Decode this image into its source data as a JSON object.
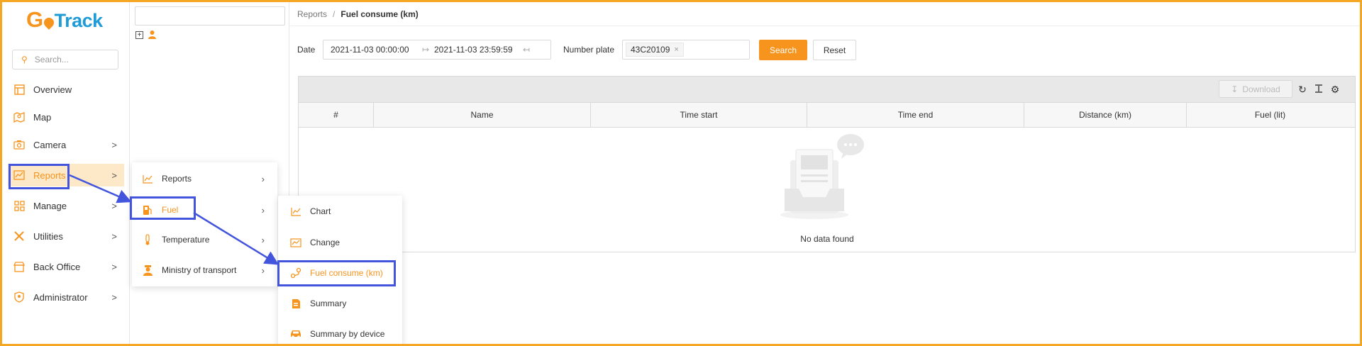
{
  "logo": {
    "text_g": "G",
    "text_rest": "Track",
    "text_o": "o"
  },
  "nav": {
    "search_placeholder": "Search...",
    "items": [
      {
        "label": "Overview",
        "icon": "layout-icon"
      },
      {
        "label": "Map",
        "icon": "map-icon"
      },
      {
        "label": "Camera",
        "icon": "camera-icon",
        "chevron": ">"
      },
      {
        "label": "Reports",
        "icon": "chart-icon",
        "chevron": ">"
      },
      {
        "label": "Manage",
        "icon": "grid-icon",
        "chevron": ">"
      },
      {
        "label": "Utilities",
        "icon": "tools-icon",
        "chevron": ">"
      },
      {
        "label": "Back Office",
        "icon": "store-icon",
        "chevron": ">"
      },
      {
        "label": "Administrator",
        "icon": "shield-icon",
        "chevron": ">"
      }
    ]
  },
  "tree": {
    "expand": "+"
  },
  "breadcrumb": {
    "parent": "Reports",
    "sep": "/",
    "current": "Fuel consume (km)"
  },
  "filters": {
    "date_label": "Date",
    "date_start": "2021-11-03 00:00:00",
    "date_end": "2021-11-03 23:59:59",
    "plate_label": "Number plate",
    "plate_value": "43C20109",
    "search_label": "Search",
    "reset_label": "Reset"
  },
  "grid": {
    "download_label": "Download",
    "columns": [
      "#",
      "Name",
      "Time start",
      "Time end",
      "Distance (km)",
      "Fuel (lit)"
    ],
    "empty_text": "No data found"
  },
  "submenu_reports": {
    "items": [
      {
        "label": "Reports",
        "icon": "line-chart-icon"
      },
      {
        "label": "Fuel",
        "icon": "fuel-pump-icon"
      },
      {
        "label": "Temperature",
        "icon": "thermometer-icon"
      },
      {
        "label": "Ministry of transport",
        "icon": "officer-icon"
      }
    ]
  },
  "submenu_fuel": {
    "items": [
      {
        "label": "Chart",
        "icon": "line-chart-icon"
      },
      {
        "label": "Change",
        "icon": "area-chart-icon"
      },
      {
        "label": "Fuel consume (km)",
        "icon": "route-icon"
      },
      {
        "label": "Summary",
        "icon": "document-icon"
      },
      {
        "label": "Summary by device",
        "icon": "car-icon"
      }
    ]
  },
  "colors": {
    "accent": "#f7941d",
    "brand_blue": "#1f9bd7",
    "highlight": "#4455dd",
    "frame": "#f5a623"
  }
}
